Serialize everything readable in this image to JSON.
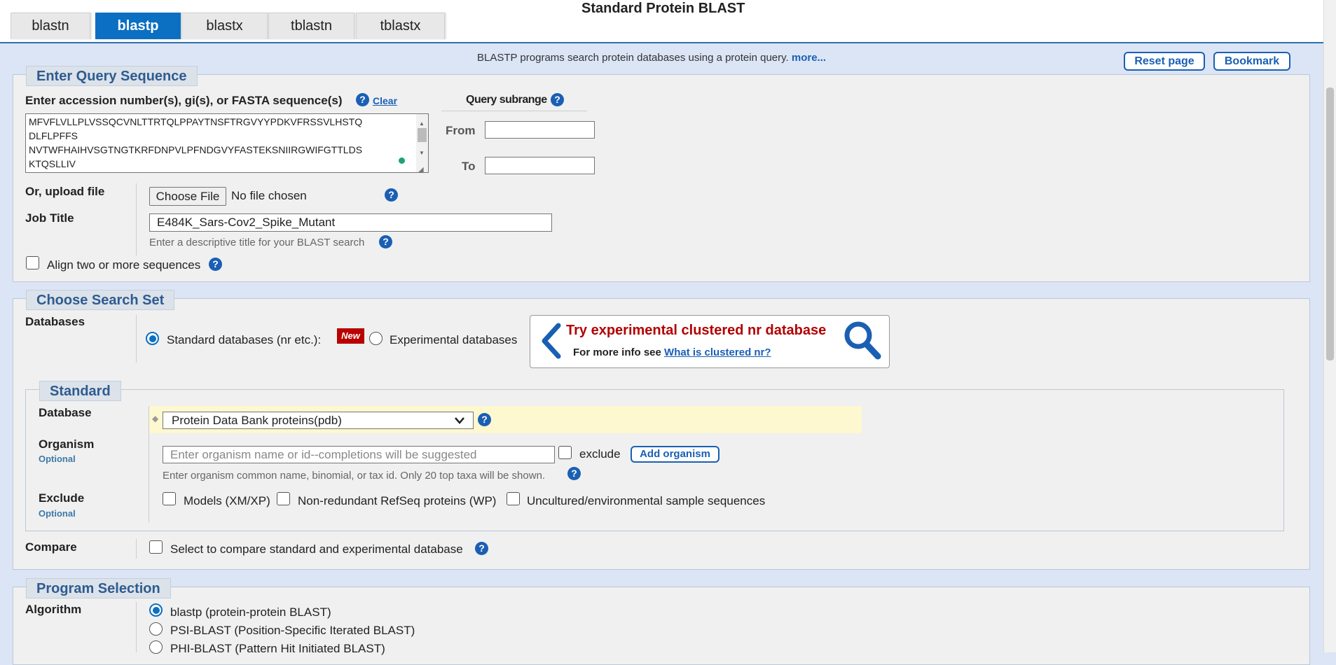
{
  "tabs": [
    "blastn",
    "blastp",
    "blastx",
    "tblastn",
    "tblastx"
  ],
  "active_tab": "blastp",
  "page_title": "Standard Protein BLAST",
  "intro": {
    "text": "BLASTP programs search protein databases using a protein query.",
    "link": "more..."
  },
  "buttons": {
    "reset": "Reset page",
    "bookmark": "Bookmark"
  },
  "query": {
    "legend": "Enter Query Sequence",
    "label": "Enter accession number(s), gi(s), or FASTA sequence(s)",
    "clear": "Clear",
    "sequence_lines": [
      "MFVFLVLLPLVSSQCVNLTTRTQLPPAYTNSFTRGVYYPDKVFRSSVLHSTQ",
      "DLFLPFFS",
      "NVTWFHAIHVSGTNGTKRFDNPVLPFNDGVYFASTEKSNIIRGWIFGTTLDS",
      "KTQSLLIV"
    ],
    "subrange_title": "Query subrange",
    "from_label": "From",
    "to_label": "To",
    "from_value": "",
    "to_value": "",
    "upload_label": "Or, upload file",
    "choose_file": "Choose File",
    "no_file": "No file chosen",
    "job_title_label": "Job Title",
    "job_title_value": "E484K_Sars-Cov2_Spike_Mutant",
    "job_title_hint": "Enter a descriptive title for your BLAST search",
    "align_label": "Align two or more sequences"
  },
  "search_set": {
    "legend": "Choose Search Set",
    "databases_label": "Databases",
    "standard_option": "Standard databases (nr etc.):",
    "new_badge": "New",
    "experimental_option": "Experimental databases",
    "promo_title": "Try experimental clustered nr database",
    "promo_text": "For more info see",
    "promo_link": "What is clustered nr?",
    "standard_legend": "Standard",
    "database_label": "Database",
    "database_value": "Protein Data Bank proteins(pdb)",
    "organism_label": "Organism",
    "optional": "Optional",
    "organism_placeholder": "Enter organism name or id--completions will be suggested",
    "exclude_word": "exclude",
    "add_organism": "Add organism",
    "organism_hint": "Enter organism common name, binomial, or tax id. Only 20 top taxa will be shown.",
    "exclude_label": "Exclude",
    "exclude_options": [
      "Models (XM/XP)",
      "Non-redundant RefSeq proteins (WP)",
      "Uncultured/environmental sample sequences"
    ],
    "compare_label": "Compare",
    "compare_text": "Select to compare standard and experimental database"
  },
  "program": {
    "legend": "Program Selection",
    "algorithm_label": "Algorithm",
    "options": [
      "blastp (protein-protein BLAST)",
      "PSI-BLAST (Position-Specific Iterated BLAST)",
      "PHI-BLAST (Pattern Hit Initiated BLAST)"
    ],
    "selected": "blastp (protein-protein BLAST)"
  },
  "colors": {
    "accent": "#0b6fc2",
    "legend_text": "#2f5b8f",
    "promo_red": "#b30000",
    "badge_red": "#b80000",
    "highlight": "#fdf8cf"
  }
}
